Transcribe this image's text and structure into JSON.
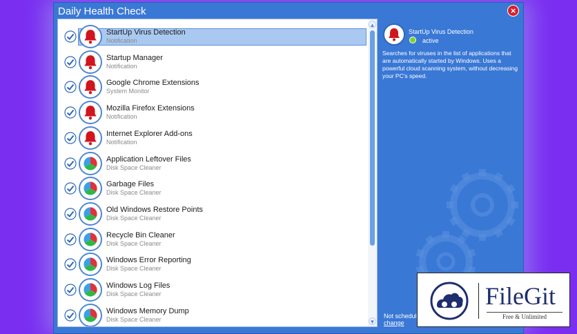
{
  "window": {
    "title": "Daily Health Check",
    "close_label": "×"
  },
  "items": [
    {
      "name": "StartUp Virus Detection",
      "category": "Notification",
      "icon": "bell-icon",
      "checked": true,
      "selected": true
    },
    {
      "name": "Startup Manager",
      "category": "Notification",
      "icon": "bell-icon",
      "checked": true,
      "selected": false
    },
    {
      "name": "Google Chrome Extensions",
      "category": "System Monitor",
      "icon": "bell-icon",
      "checked": true,
      "selected": false
    },
    {
      "name": "Mozilla Firefox Extensions",
      "category": "Notification",
      "icon": "bell-icon",
      "checked": true,
      "selected": false
    },
    {
      "name": "Internet Explorer Add-ons",
      "category": "Notification",
      "icon": "bell-icon",
      "checked": true,
      "selected": false
    },
    {
      "name": "Application Leftover Files",
      "category": "Disk Space Cleaner",
      "icon": "pie-icon",
      "checked": true,
      "selected": false
    },
    {
      "name": "Garbage Files",
      "category": "Disk Space Cleaner",
      "icon": "pie-icon",
      "checked": true,
      "selected": false
    },
    {
      "name": "Old Windows Restore Points",
      "category": "Disk Space Cleaner",
      "icon": "pie-icon",
      "checked": true,
      "selected": false
    },
    {
      "name": "Recycle Bin Cleaner",
      "category": "Disk Space Cleaner",
      "icon": "pie-icon",
      "checked": true,
      "selected": false
    },
    {
      "name": "Windows Error Reporting",
      "category": "Disk Space Cleaner",
      "icon": "pie-icon",
      "checked": true,
      "selected": false
    },
    {
      "name": "Windows Log Files",
      "category": "Disk Space Cleaner",
      "icon": "pie-icon",
      "checked": true,
      "selected": false
    },
    {
      "name": "Windows Memory Dump",
      "category": "Disk Space Cleaner",
      "icon": "pie-icon",
      "checked": true,
      "selected": false
    }
  ],
  "detail": {
    "title": "StartUp Virus Detection",
    "status": "active",
    "description": "Searches for viruses in the list of applications that are automatically started by Windows. Uses a powerful cloud scanning system, without decreasing your PC's speed.",
    "schedule_text": "Not schedule",
    "change_label": "change"
  },
  "watermark": {
    "name": "FileGit",
    "tagline": "Free & Unlimited"
  },
  "colors": {
    "background": "#7a2ff0",
    "window": "#3a78d6",
    "selection": "#a9c9f0",
    "bell": "#d0151d",
    "status_active": "#7ed321",
    "pie": [
      "#2db84a",
      "#e0323b",
      "#3aa0e8"
    ]
  }
}
